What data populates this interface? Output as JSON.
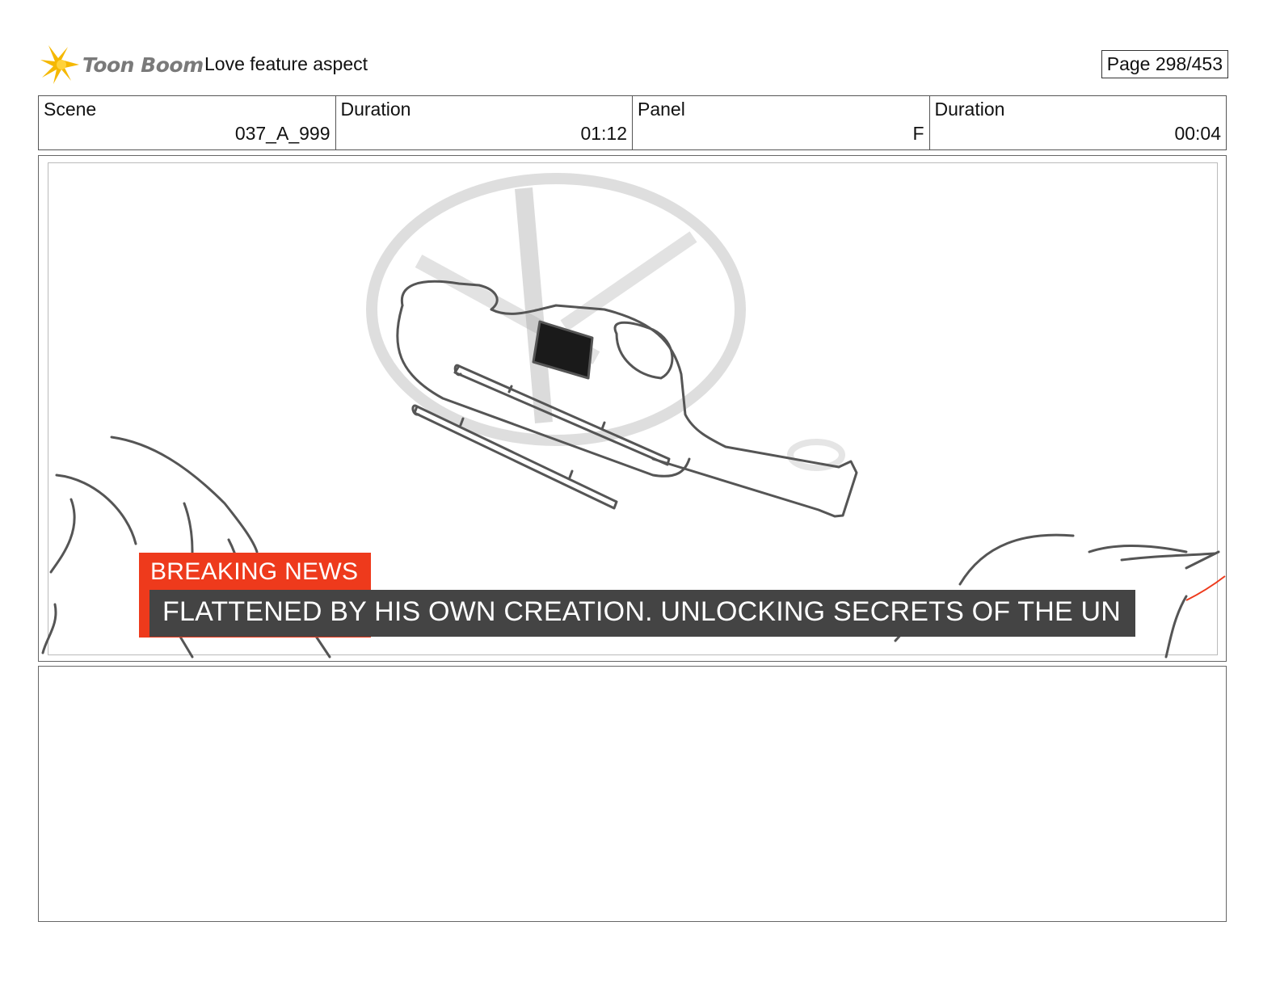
{
  "header": {
    "logo_text": "Toon Boom",
    "project_title": "Love feature aspect",
    "page_label": "Page 298/453"
  },
  "info": {
    "scene_label": "Scene",
    "scene_value": "037_A_999",
    "scene_duration_label": "Duration",
    "scene_duration_value": "01:12",
    "panel_label": "Panel",
    "panel_value": "F",
    "panel_duration_label": "Duration",
    "panel_duration_value": "00:04"
  },
  "panel": {
    "breaking_label": "BREAKING NEWS",
    "ticker_text": "FLATTENED BY HIS OWN CREATION. UNLOCKING SECRETS OF THE UN"
  },
  "notes": {
    "text": ""
  },
  "colors": {
    "breaking_red": "#ee3a1c",
    "ticker_gray": "#444444",
    "logo_yellow": "#f5b800"
  }
}
